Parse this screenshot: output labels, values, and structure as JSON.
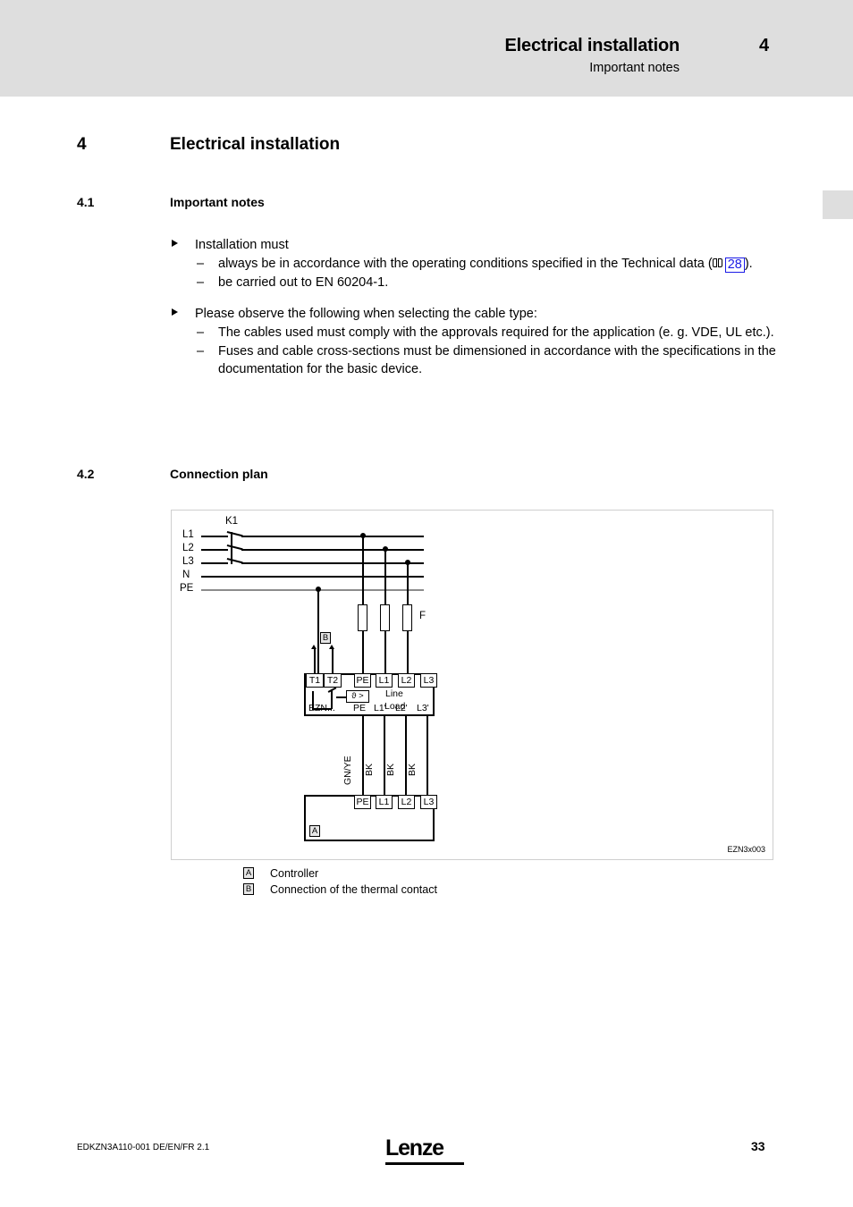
{
  "header": {
    "title": "Electrical installation",
    "subtitle": "Important notes",
    "chapter_number": "4"
  },
  "sections": {
    "chapter": {
      "number": "4",
      "title": "Electrical installation"
    },
    "s41": {
      "number": "4.1",
      "title": "Important notes"
    },
    "s42": {
      "number": "4.2",
      "title": "Connection plan"
    }
  },
  "notes": {
    "b1": "Installation must",
    "b1s1_pre": "always be in accordance with the operating conditions specified in the Technical data (",
    "b1s1_link": "28",
    "b1s1_post": ").",
    "b1s2": "be carried out to EN 60204-1.",
    "b2": "Please observe the following when selecting the cable type:",
    "b2s1": "The cables used must comply with the approvals required for the application (e. g. VDE, UL etc.).",
    "b2s2": "Fuses and cable cross-sections must be dimensioned in accordance with the specifications in the documentation for the basic device.",
    "dash": "–"
  },
  "diagram": {
    "id": "EZN3x003",
    "rails": [
      "L1",
      "L2",
      "L3",
      "N",
      "PE"
    ],
    "contactor_label": "K1",
    "fuse_label": "F",
    "marker_b": "B",
    "marker_a": "A",
    "ezn": {
      "device_label": "EZN...",
      "thermal_terminals": [
        "T1",
        "T2"
      ],
      "thermal_symbol": "ϑ >",
      "line_label": "Line",
      "load_label": "Load",
      "line_terminals": [
        "PE",
        "L1",
        "L2",
        "L3"
      ],
      "load_terminals": [
        "PE",
        "L1'",
        "L2'",
        "L3'"
      ]
    },
    "cable_colors": [
      "GN/YE",
      "BK",
      "BK",
      "BK"
    ],
    "controller_terminals": [
      "PE",
      "L1",
      "L2",
      "L3"
    ]
  },
  "legend": [
    {
      "marker": "A",
      "text": "Controller"
    },
    {
      "marker": "B",
      "text": "Connection of the thermal contact"
    }
  ],
  "footer": {
    "doc_id": "EDKZN3A110-001  DE/EN/FR  2.1",
    "logo": "Lenze",
    "page_number": "33"
  },
  "colors": {
    "header_bg": "#dedede",
    "link": "#1a1ae6",
    "wire": "#000000",
    "pe_wire": "#8c8c8c"
  }
}
